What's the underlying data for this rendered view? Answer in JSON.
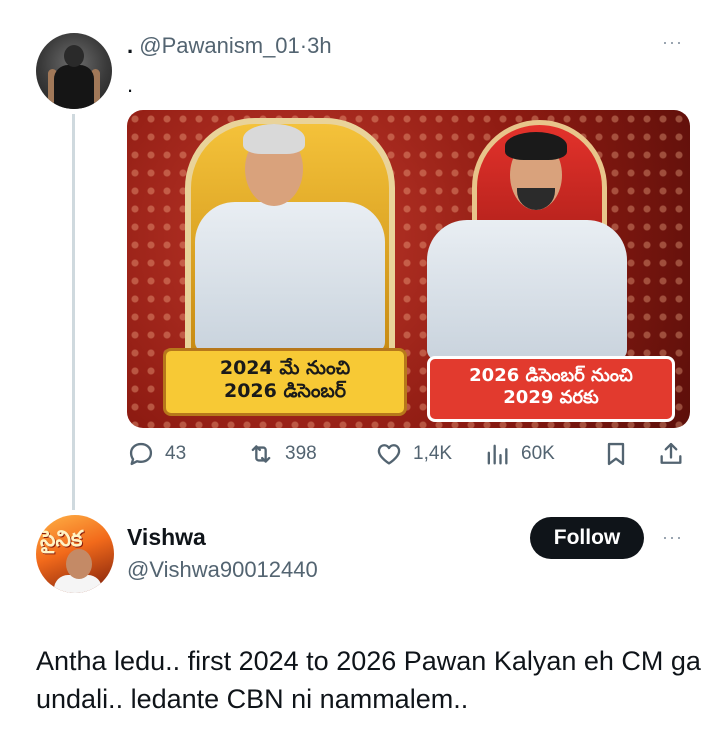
{
  "tweet": {
    "display_name": ".",
    "handle": "@Pawanism_01",
    "separator": "·",
    "time": "3h",
    "text": ".",
    "more_label": "···",
    "media": {
      "caption_left_line1": "2024 మే నుంచి",
      "caption_left_line2": "2026 డిసెంబర్",
      "caption_right_line1": "2026 డిసెంబర్ నుంచి",
      "caption_right_line2": "2029 వరకు"
    },
    "actions": {
      "replies": "43",
      "retweets": "398",
      "likes": "1,4K",
      "views": "60K"
    }
  },
  "reply": {
    "display_name": "Vishwa",
    "handle": "@Vishwa90012440",
    "follow_label": "Follow",
    "more_label": "···",
    "avatar_text": "సైనిక",
    "text": "Antha ledu.. first 2024 to 2026 Pawan Kalyan eh CM ga undali.. ledante CBN ni nammalem.."
  },
  "icons": [
    "reply-icon",
    "retweet-icon",
    "like-icon",
    "views-icon",
    "bookmark-icon",
    "share-icon",
    "more-icon"
  ],
  "colors": {
    "text_primary": "#0f1419",
    "text_secondary": "#536471",
    "thread_line": "#cfd9de",
    "follow_button_bg": "#0f1419"
  }
}
